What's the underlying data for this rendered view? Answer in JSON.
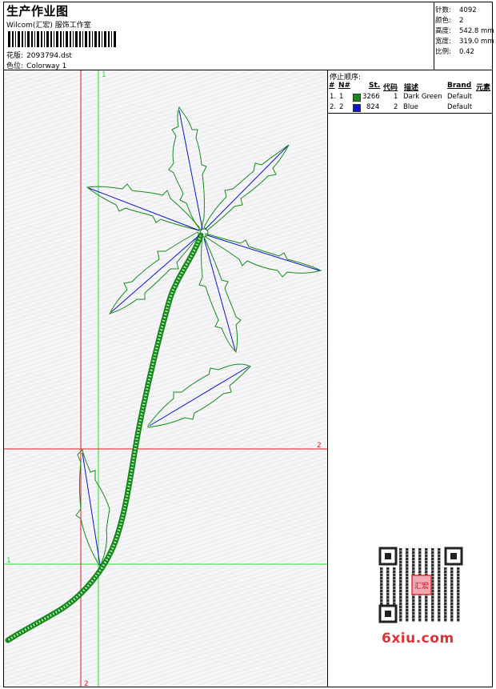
{
  "header": {
    "title": "生产作业图",
    "subtitle": "Wilcom(汇宏) 服饰工作室",
    "design_label": "花版:",
    "design_value": "2093794.dst",
    "colorway_label": "色位:",
    "colorway_value": "Colorway 1"
  },
  "stats": [
    {
      "label": "针数:",
      "value": "4092"
    },
    {
      "label": "颜色:",
      "value": "2"
    },
    {
      "label": "高度:",
      "value": "542.8 mm"
    },
    {
      "label": "宽度:",
      "value": "319.0 mm"
    },
    {
      "label": "比例:",
      "value": "0.42"
    }
  ],
  "stop_sequence": {
    "title": "停止顺序:",
    "columns": [
      "#",
      "N#",
      "St.",
      "代码",
      "描述",
      "Brand",
      "元素"
    ],
    "rows": [
      {
        "index": "1.",
        "n": "1",
        "stitches": "3266",
        "code": "1",
        "description": "Dark Green",
        "brand": "Default",
        "color": "#178a1c"
      },
      {
        "index": "2.",
        "n": "2",
        "stitches": "824",
        "code": "2",
        "description": "Blue",
        "brand": "Default",
        "color": "#0a14c8"
      }
    ]
  },
  "guides": {
    "green_top": "1",
    "green_left": "1",
    "red_right": "2",
    "red_bottom": "2"
  },
  "colors": {
    "dark_green": "#178a1c",
    "blue": "#0a14c8",
    "guide_green": "#27e02a",
    "guide_red": "#e31b1b"
  },
  "watermark": {
    "stamp_text": "汇宏",
    "site": "6xiu.com"
  }
}
